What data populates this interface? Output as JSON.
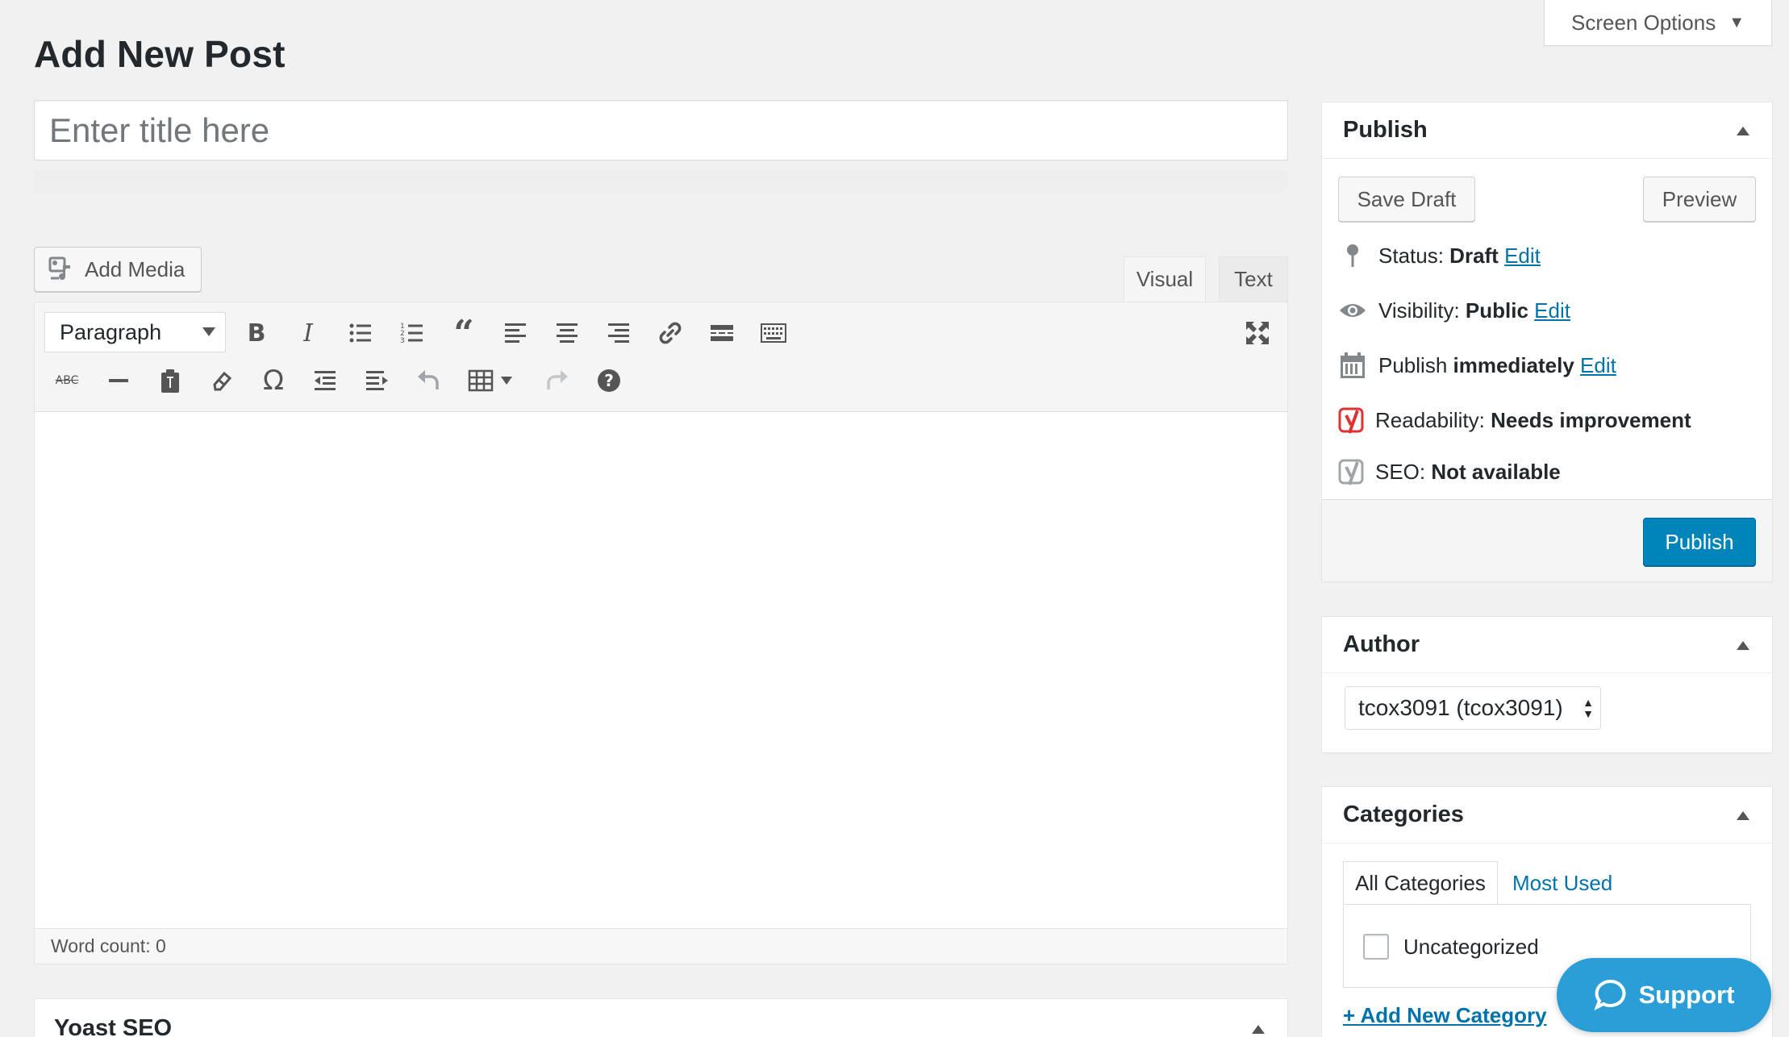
{
  "page": {
    "title": "Add New Post",
    "screen_options": "Screen Options"
  },
  "post": {
    "title_placeholder": "Enter title here"
  },
  "editor": {
    "add_media": "Add Media",
    "tabs": {
      "visual": "Visual",
      "text": "Text"
    },
    "format": "Paragraph",
    "word_count": "Word count: 0"
  },
  "yoast": {
    "title": "Yoast SEO"
  },
  "publish_box": {
    "title": "Publish",
    "save_draft": "Save Draft",
    "preview": "Preview",
    "status_label": "Status:",
    "status_value": "Draft",
    "visibility_label": "Visibility:",
    "visibility_value": "Public",
    "publish_label": "Publish",
    "publish_value": "immediately",
    "edit": "Edit",
    "readability_label": "Readability:",
    "readability_value": "Needs improvement",
    "seo_label": "SEO:",
    "seo_value": "Not available",
    "publish_button": "Publish"
  },
  "author_box": {
    "title": "Author",
    "selected": "tcox3091 (tcox3091)"
  },
  "categories_box": {
    "title": "Categories",
    "tab_all": "All Categories",
    "tab_most_used": "Most Used",
    "items": [
      "Uncategorized"
    ],
    "add_new": "+ Add New Category"
  },
  "support": {
    "label": "Support"
  },
  "colors": {
    "primary": "#0085ba",
    "link": "#0073aa",
    "support": "#2b9ed8",
    "yoast_red": "#dc3232"
  }
}
